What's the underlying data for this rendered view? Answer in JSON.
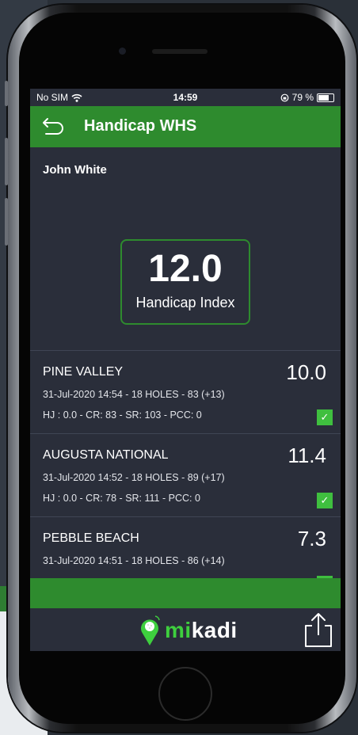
{
  "status": {
    "carrier": "No SIM",
    "time": "14:59",
    "battery": "79 %",
    "battery_level": 0.79
  },
  "header": {
    "title": "Handicap WHS"
  },
  "player": {
    "name": "John White"
  },
  "handicap": {
    "value": "12.0",
    "label": "Handicap Index"
  },
  "rounds": [
    {
      "course": "PINE VALLEY",
      "differential": "10.0",
      "meta": "31-Jul-2020 14:54 - 18 HOLES - 83 (+13)",
      "details": "HJ : 0.0 - CR: 83 - SR: 103 - PCC: 0",
      "counted": true
    },
    {
      "course": "AUGUSTA NATIONAL",
      "differential": "11.4",
      "meta": "31-Jul-2020 14:52 - 18 HOLES - 89 (+17)",
      "details": "HJ : 0.0 - CR: 78 - SR: 111 - PCC: 0",
      "counted": true
    },
    {
      "course": "PEBBLE BEACH",
      "differential": "7.3",
      "meta": "31-Jul-2020 14:51 - 18 HOLES - 86 (+14)",
      "details": "",
      "counted": true
    }
  ],
  "footer": {
    "logo_prefix": "mi",
    "logo_suffix": "kadi"
  },
  "colors": {
    "brand_green": "#2e8b2e",
    "logo_green": "#3ecf3e",
    "screen_bg": "#2a2e3a"
  }
}
